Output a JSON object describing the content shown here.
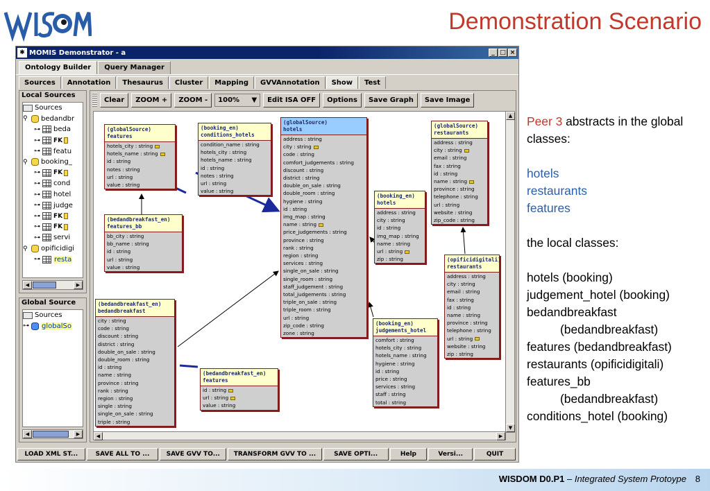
{
  "slide": {
    "title": "Demonstration Scenario",
    "logo_text": "WISDOM",
    "footer": {
      "project": "WISDOM D0.P1",
      "dash": " – ",
      "subtitle": "Integrated System Protoype",
      "page": "8"
    }
  },
  "window": {
    "title": "MOMIS Demonstrator - a",
    "controls": [
      "_",
      "□",
      "×"
    ],
    "tabs": [
      "Ontology Builder",
      "Query Manager"
    ],
    "subtabs": [
      "Sources",
      "Annotation",
      "Thesaurus",
      "Cluster",
      "Mapping",
      "GVVAnnotation",
      "Show",
      "Test"
    ],
    "active_subtab": "Show"
  },
  "local_sources": {
    "title": "Local Sources",
    "items": [
      {
        "label": "Sources"
      },
      {
        "label": "bedandbr"
      },
      {
        "label": "beda"
      },
      {
        "label": "FK"
      },
      {
        "label": "featu"
      },
      {
        "label": "booking_"
      },
      {
        "label": "FK"
      },
      {
        "label": "cond"
      },
      {
        "label": "hotel"
      },
      {
        "label": "judge"
      },
      {
        "label": "FK"
      },
      {
        "label": "FK"
      },
      {
        "label": "servi"
      },
      {
        "label": "opificidigi"
      },
      {
        "label": "resta"
      }
    ]
  },
  "global_source": {
    "title": "Global Source",
    "items": [
      {
        "label": "Sources"
      },
      {
        "label": "globalSo"
      }
    ]
  },
  "toolbar": {
    "clear": "Clear",
    "zoom_in": "ZOOM +",
    "zoom_out": "ZOOM -",
    "zoom_value": "100%",
    "edit_isa": "Edit ISA OFF",
    "options": "Options",
    "save_graph": "Save Graph",
    "save_image": "Save Image"
  },
  "classes": [
    {
      "id": "gs-features",
      "source": "(globalSource)",
      "name": "features",
      "blue": false,
      "attrs": [
        "hotels_city : string",
        "hotels_name : string",
        "id : string",
        "notes : string",
        "url : string",
        "value : string"
      ],
      "keys": [
        0,
        1
      ]
    },
    {
      "id": "bk-conditions",
      "source": "(booking_en)",
      "name": "conditions_hotels",
      "blue": false,
      "attrs": [
        "condition_name : string",
        "hotels_city : string",
        "hotels_name : string",
        "id : string",
        "notes : string",
        "url : string",
        "value : string"
      ],
      "keys": []
    },
    {
      "id": "gs-hotels",
      "source": "(globalSource)",
      "name": "hotels",
      "blue": true,
      "attrs": [
        "address : string",
        "city : string",
        "code : string",
        "comfort_judgements : string",
        "discount : string",
        "district : string",
        "double_on_sale : string",
        "double_room : string",
        "hygiene : string",
        "id : string",
        "img_map : string",
        "name : string",
        "price_judgements : string",
        "province : string",
        "rank : string",
        "region : string",
        "services : string",
        "single_on_sale : string",
        "single_room : string",
        "staff_judgement : string",
        "total_judgements : string",
        "triple_on_sale : string",
        "triple_room : string",
        "url : string",
        "zip_code : string",
        "zone : string"
      ],
      "keys": [
        1,
        11
      ]
    },
    {
      "id": "gs-restaurants",
      "source": "(globalSource)",
      "name": "restaurants",
      "blue": false,
      "attrs": [
        "address : string",
        "city : string",
        "email : string",
        "fax : string",
        "id : string",
        "name : string",
        "province : string",
        "telephone : string",
        "url : string",
        "website : string",
        "zip_code : string"
      ],
      "keys": [
        1,
        5
      ]
    },
    {
      "id": "bk-hotels",
      "source": "(booking_en)",
      "name": "hotels",
      "blue": false,
      "attrs": [
        "address : string",
        "city : string",
        "id : string",
        "img_map : string",
        "name : string",
        "url : string",
        "zip : string"
      ],
      "keys": [
        5
      ]
    },
    {
      "id": "bb-features-bb",
      "source": "(bedandbreakfast_en)",
      "name": "features_bb",
      "blue": false,
      "attrs": [
        "bb_city : string",
        "bb_name : string",
        "id : string",
        "url : string",
        "value : string"
      ],
      "keys": []
    },
    {
      "id": "op-restaurants",
      "source": "(opificidigitali)",
      "name": "restaurants",
      "blue": false,
      "attrs": [
        "address : string",
        "city : string",
        "email : string",
        "fax : string",
        "id : string",
        "name : string",
        "province : string",
        "telephone : string",
        "url : string",
        "website : string",
        "zip : string"
      ],
      "keys": [
        8
      ]
    },
    {
      "id": "bb-bedandbreakfast",
      "source": "(bedandbreakfast_en)",
      "name": "bedandbreakfast",
      "blue": false,
      "attrs": [
        "city : string",
        "code : string",
        "discount : string",
        "district : string",
        "double_on_sale : string",
        "double_room : string",
        "id : string",
        "name : string",
        "province : string",
        "rank : string",
        "region : string",
        "single : string",
        "single_on_sale : string",
        "triple : string"
      ],
      "keys": []
    },
    {
      "id": "bk-judgements",
      "source": "(booking_en)",
      "name": "judgements_hotel",
      "blue": false,
      "attrs": [
        "comfort : string",
        "hotels_city : string",
        "hotels_name : string",
        "hygiene : string",
        "id : string",
        "price : string",
        "services : string",
        "staff : string",
        "total : string"
      ],
      "keys": []
    },
    {
      "id": "bb-features",
      "source": "(bedandbreakfast_en)",
      "name": "features",
      "blue": false,
      "attrs": [
        "id : string",
        "url : string",
        "value : string"
      ],
      "keys": [
        0,
        1
      ]
    }
  ],
  "bottom_buttons": [
    "LOAD XML ST...",
    "SAVE ALL TO ...",
    "SAVE GVV TO...",
    "TRANSFORM GVV TO ...",
    "SAVE OPTI...",
    "Help",
    "Versi...",
    "QUIT"
  ],
  "description": {
    "peer": "Peer 3",
    "intro": " abstracts in the global classes:",
    "global_classes": [
      "hotels",
      "restaurants",
      "features"
    ],
    "local_intro": "the local classes:",
    "local_classes": [
      {
        "text": "hotels (booking)",
        "indent": false
      },
      {
        "text": "judgement_hotel (booking)",
        "indent": false
      },
      {
        "text": "bedandbreakfast",
        "indent": false
      },
      {
        "text": "(bedandbreakfast)",
        "indent": true
      },
      {
        "text": "features (bedandbreakfast)",
        "indent": false
      },
      {
        "text": "restaurants (opificidigitali)",
        "indent": false
      },
      {
        "text": "features_bb",
        "indent": false
      },
      {
        "text": "(bedandbreakfast)",
        "indent": true
      },
      {
        "text": "conditions_hotel (booking)",
        "indent": false
      }
    ]
  },
  "colors": {
    "title": "#c0392b",
    "accent_blue": "#2a5da8",
    "titlebar": "#0a246a",
    "box_border": "#7a1e1e",
    "header_yellow": "#ffffcc",
    "header_blue": "#99ccff"
  }
}
